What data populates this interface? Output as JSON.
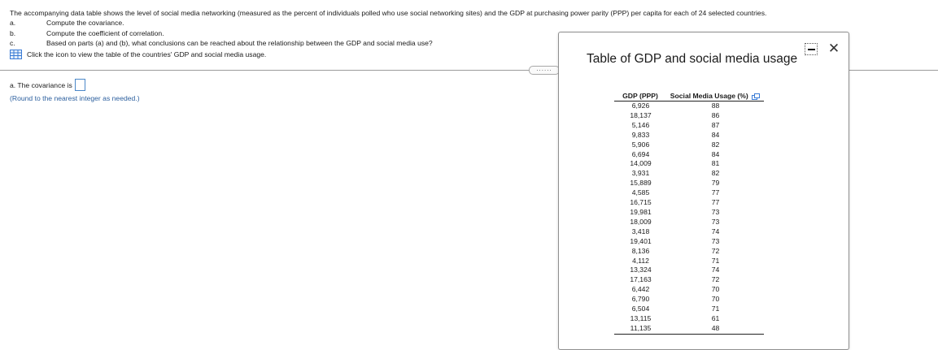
{
  "question": {
    "intro": "The accompanying data table shows the level of social media networking (measured as the percent of individuals polled who use social networking sites) and the GDP at purchasing power parity (PPP) per capita for each of 24 selected countries.",
    "parts": [
      {
        "letter": "a.",
        "text": "Compute the covariance."
      },
      {
        "letter": "b.",
        "text": "Compute the coefficient of correlation."
      },
      {
        "letter": "c.",
        "text": "Based on parts (a) and (b), what conclusions can be reached about the relationship between the GDP and social media use?"
      }
    ],
    "table_link": "Click the icon to view the table of the countries' GDP and social media usage.",
    "handle_dots": "......"
  },
  "answer": {
    "label": "a. The covariance is",
    "value": "",
    "hint": "(Round to the nearest integer as needed.)"
  },
  "popup": {
    "title": "Table of GDP and social media usage",
    "minimize_icon": "minimize-icon",
    "close_glyph": "✕",
    "columns": [
      "GDP (PPP)",
      "Social Media Usage (%)"
    ],
    "rows": [
      [
        "6,926",
        "88"
      ],
      [
        "18,137",
        "86"
      ],
      [
        "5,146",
        "87"
      ],
      [
        "9,833",
        "84"
      ],
      [
        "5,906",
        "82"
      ],
      [
        "6,694",
        "84"
      ],
      [
        "14,009",
        "81"
      ],
      [
        "3,931",
        "82"
      ],
      [
        "15,889",
        "79"
      ],
      [
        "4,585",
        "77"
      ],
      [
        "16,715",
        "77"
      ],
      [
        "19,981",
        "73"
      ],
      [
        "18,009",
        "73"
      ],
      [
        "3,418",
        "74"
      ],
      [
        "19,401",
        "73"
      ],
      [
        "8,136",
        "72"
      ],
      [
        "4,112",
        "71"
      ],
      [
        "13,324",
        "74"
      ],
      [
        "17,163",
        "72"
      ],
      [
        "6,442",
        "70"
      ],
      [
        "6,790",
        "70"
      ],
      [
        "6,504",
        "71"
      ],
      [
        "13,115",
        "61"
      ],
      [
        "11,135",
        "48"
      ]
    ]
  },
  "colors": {
    "accent": "#2c5f9e",
    "answer_border": "#4a87c8",
    "icon_blue": "#3a7bd5"
  }
}
